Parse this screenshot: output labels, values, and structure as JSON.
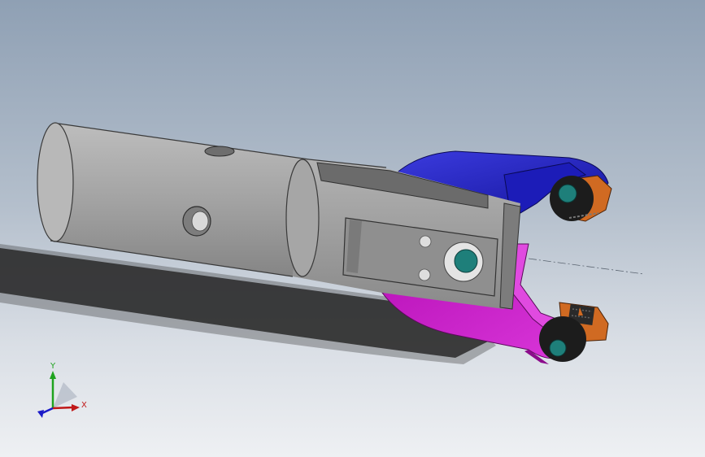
{
  "view": {
    "background_top": "#8fa0b4",
    "background_bottom": "#eef0f3"
  },
  "model": {
    "parts": [
      {
        "name": "tube",
        "color": "#a4a4a4"
      },
      {
        "name": "collar",
        "color": "#9a9a9a"
      },
      {
        "name": "upper-jaw",
        "color": "#2323c8"
      },
      {
        "name": "lower-jaw",
        "color": "#c217c2"
      },
      {
        "name": "pivot-pin",
        "color": "#1e7f7a"
      },
      {
        "name": "roller",
        "color": "#1c1c1c"
      },
      {
        "name": "pad",
        "color": "#e07a2c"
      }
    ]
  },
  "triad": {
    "x_label": "X",
    "y_label": "Y",
    "x_color": "#c01818",
    "y_color": "#1fa31f",
    "z_color": "#1a1ac8"
  }
}
